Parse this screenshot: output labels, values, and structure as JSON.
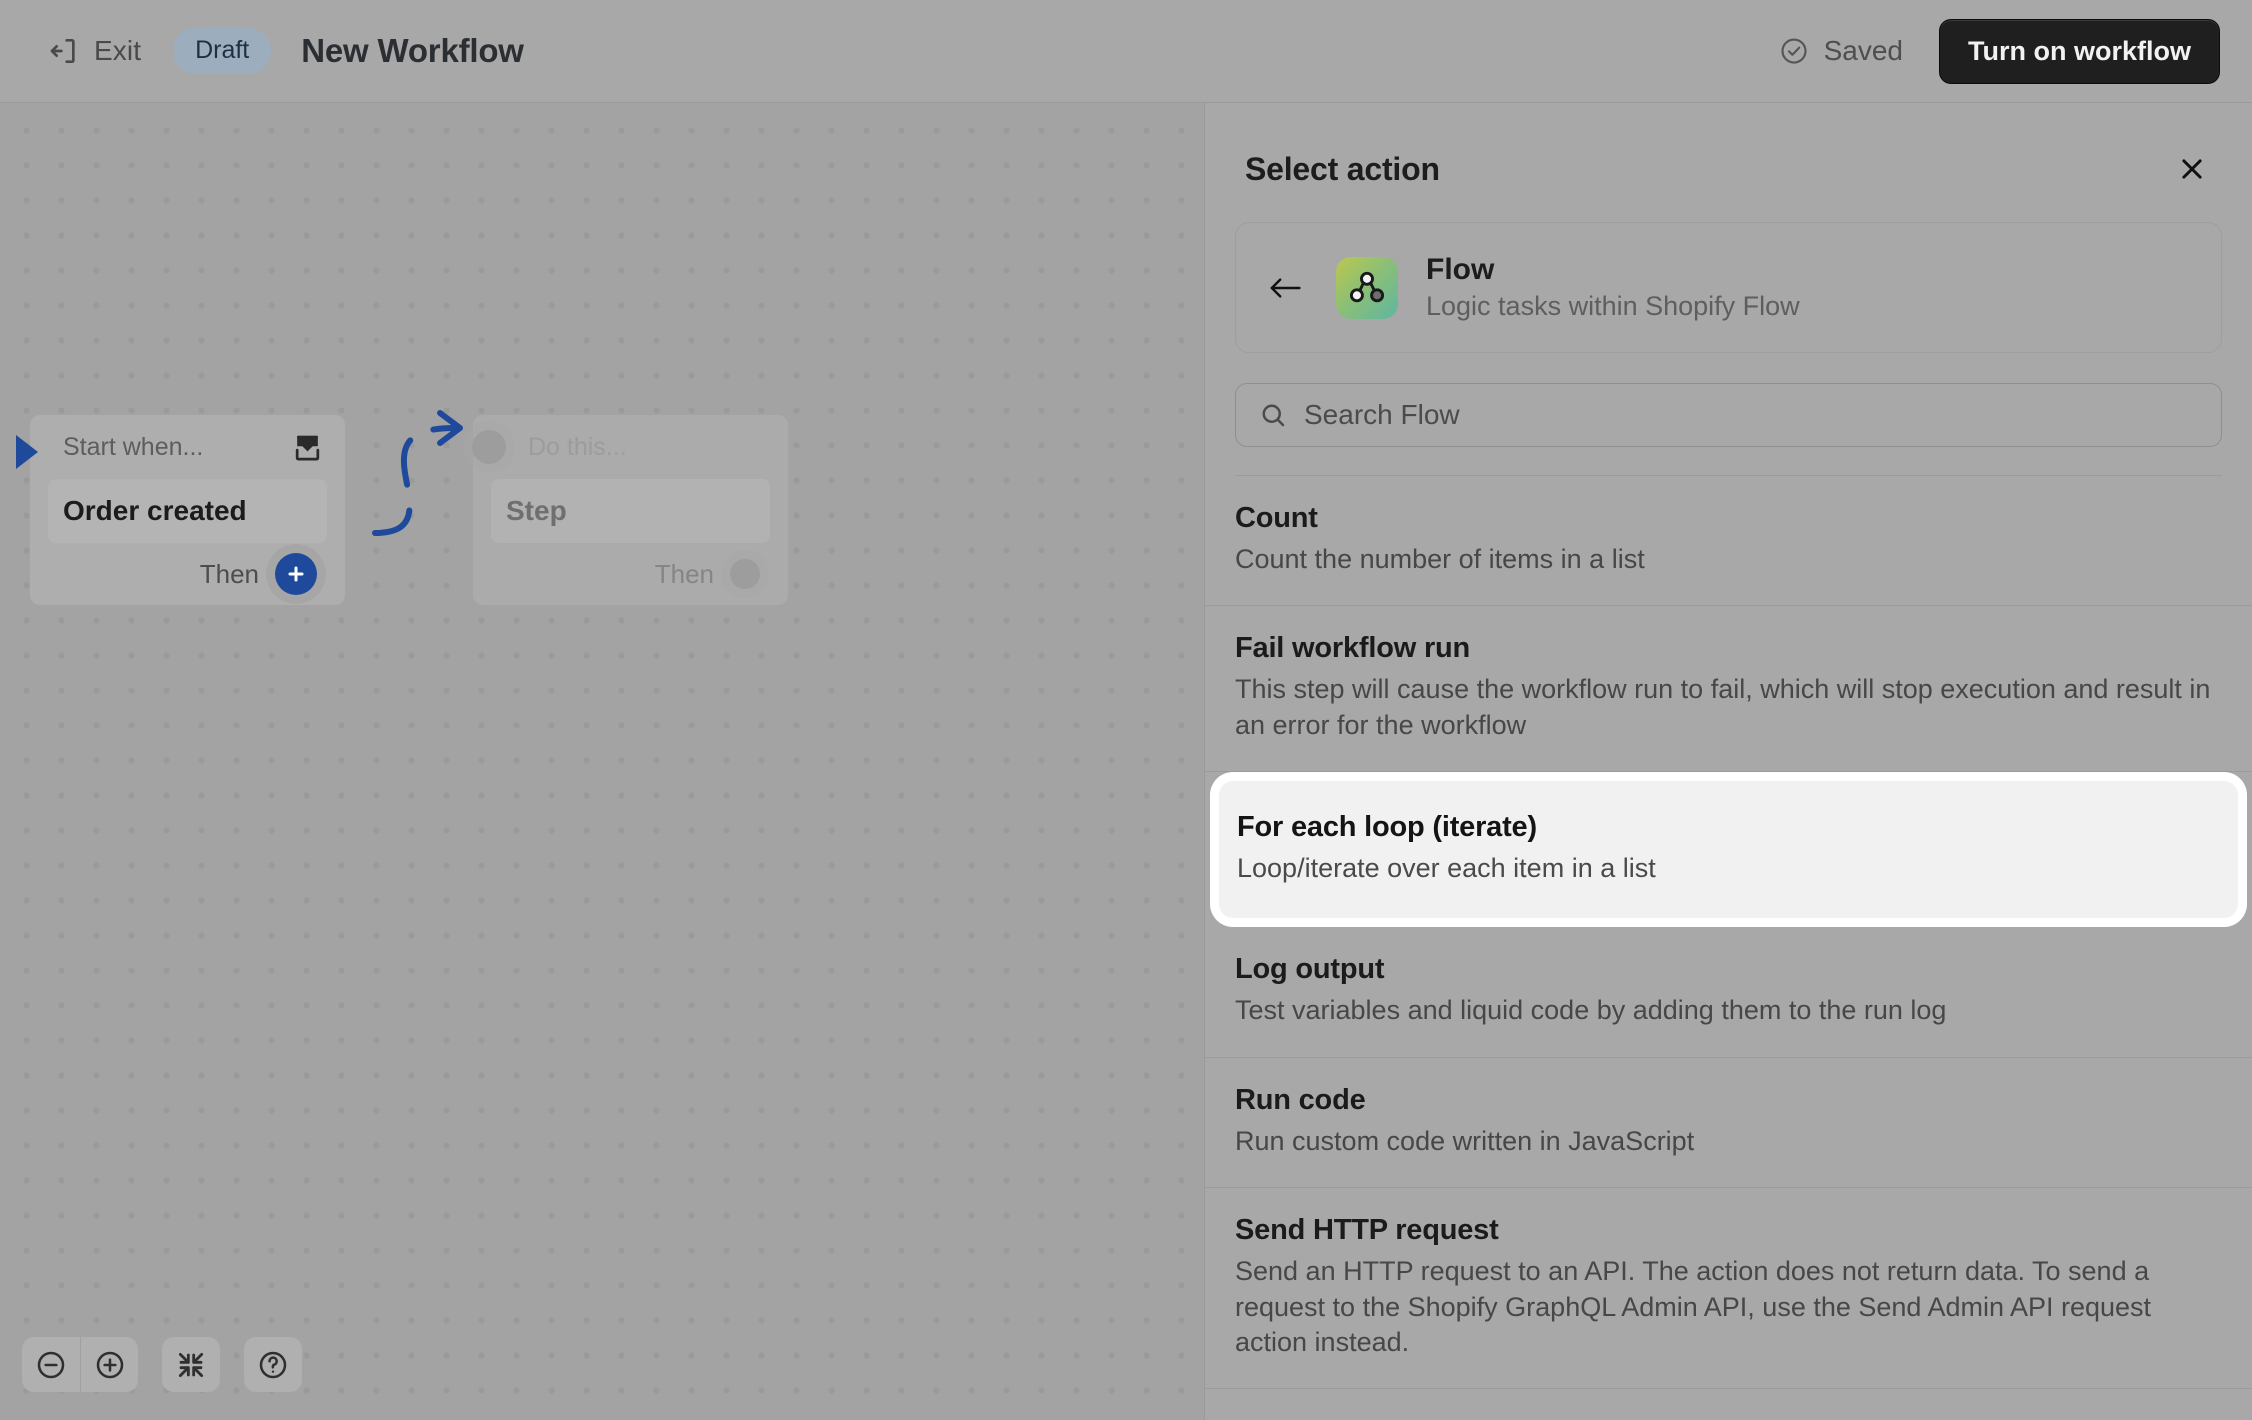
{
  "topbar": {
    "exit_label": "Exit",
    "exit_icon": "exit-icon",
    "status_badge": "Draft",
    "workflow_title": "New Workflow",
    "saved_label": "Saved",
    "saved_icon": "check-circle-icon",
    "turn_on_label": "Turn on workflow"
  },
  "canvas": {
    "trigger": {
      "header_label": "Start when...",
      "title": "Order created",
      "footer_label": "Then",
      "header_icon": "import-icon",
      "add_icon": "plus-icon"
    },
    "step": {
      "header_label": "Do this...",
      "title": "Step",
      "footer_label": "Then"
    },
    "controls": {
      "zoom_out": "zoom-out-icon",
      "zoom_in": "zoom-in-icon",
      "fit_screen": "collapse-icon",
      "help": "help-icon"
    }
  },
  "panel": {
    "title": "Select action",
    "close_icon": "close-icon",
    "back_icon": "arrow-left-icon",
    "category": {
      "icon": "flow-icon",
      "name": "Flow",
      "description": "Logic tasks within Shopify Flow"
    },
    "search": {
      "icon": "search-icon",
      "placeholder": "Search Flow",
      "value": ""
    },
    "actions": [
      {
        "title": "Count",
        "description": "Count the number of items in a list",
        "selected": false
      },
      {
        "title": "Fail workflow run",
        "description": "This step will cause the workflow run to fail, which will stop execution and result in an error for the workflow",
        "selected": false
      },
      {
        "title": "For each loop (iterate)",
        "description": "Loop/iterate over each item in a list",
        "selected": true
      },
      {
        "title": "Log output",
        "description": "Test variables and liquid code by adding them to the run log",
        "selected": false
      },
      {
        "title": "Run code",
        "description": "Run custom code written in JavaScript",
        "selected": false
      },
      {
        "title": "Send HTTP request",
        "description": "Send an HTTP request to an API. The action does not return data. To send a request to the Shopify GraphQL Admin API, use the Send Admin API request action instead.",
        "selected": false
      }
    ]
  },
  "colors": {
    "accent_blue": "#1f4a9c",
    "badge_bg": "#9cadbd",
    "badge_text": "#1f3045",
    "primary_button_bg": "#1f1f1f",
    "canvas_bg": "#a3a3a3",
    "panel_bg": "#a8a8a8",
    "selected_item_bg": "#f1f1f1",
    "selected_item_ring": "#ffffff"
  }
}
